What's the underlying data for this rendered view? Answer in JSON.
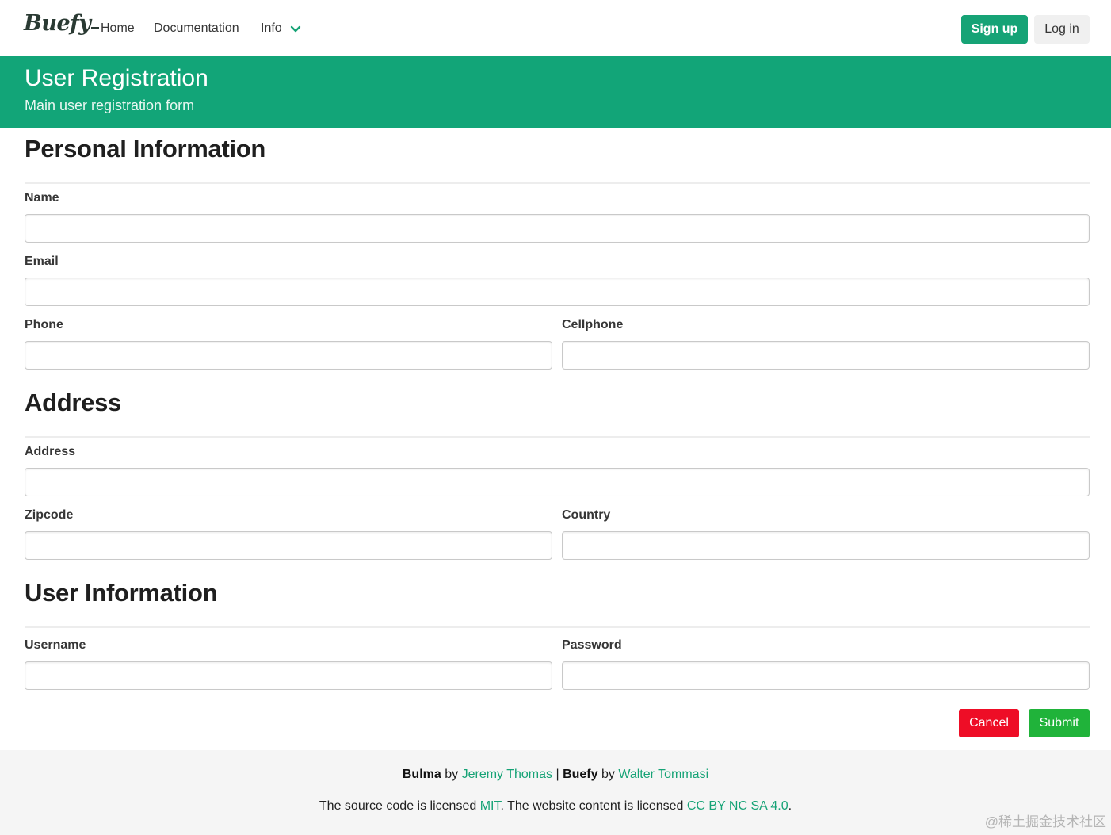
{
  "navbar": {
    "brand": "Buefy",
    "items": [
      {
        "label": "Home"
      },
      {
        "label": "Documentation"
      },
      {
        "label": "Info"
      }
    ],
    "signup_label": "Sign up",
    "login_label": "Log in",
    "accent_color": "#16a376"
  },
  "hero": {
    "title": "User Registration",
    "subtitle": "Main user registration form",
    "background_color": "#12a578"
  },
  "sections": {
    "personal": {
      "title": "Personal Information",
      "name_label": "Name",
      "email_label": "Email",
      "phone_label": "Phone",
      "cellphone_label": "Cellphone"
    },
    "address": {
      "title": "Address",
      "address_label": "Address",
      "zipcode_label": "Zipcode",
      "country_label": "Country"
    },
    "user": {
      "title": "User Information",
      "username_label": "Username",
      "password_label": "Password"
    }
  },
  "form_fields": {
    "name": "",
    "email": "",
    "phone": "",
    "cellphone": "",
    "address": "",
    "zipcode": "",
    "country": "",
    "username": "",
    "password": ""
  },
  "actions": {
    "cancel_label": "Cancel",
    "submit_label": "Submit",
    "cancel_color": "#ee0d26",
    "submit_color": "#20b33a"
  },
  "footer": {
    "bulma": "Bulma",
    "by1": "by",
    "jeremy": "Jeremy Thomas",
    "sep": "|",
    "buefy": "Buefy",
    "by2": "by",
    "walter": "Walter Tommasi",
    "license_prefix": "The source code is licensed",
    "mit": "MIT",
    "license_middle": ". The website content is licensed",
    "cc": "CC BY NC SA 4.0",
    "license_suffix": "."
  },
  "watermark": "@稀土掘金技术社区"
}
